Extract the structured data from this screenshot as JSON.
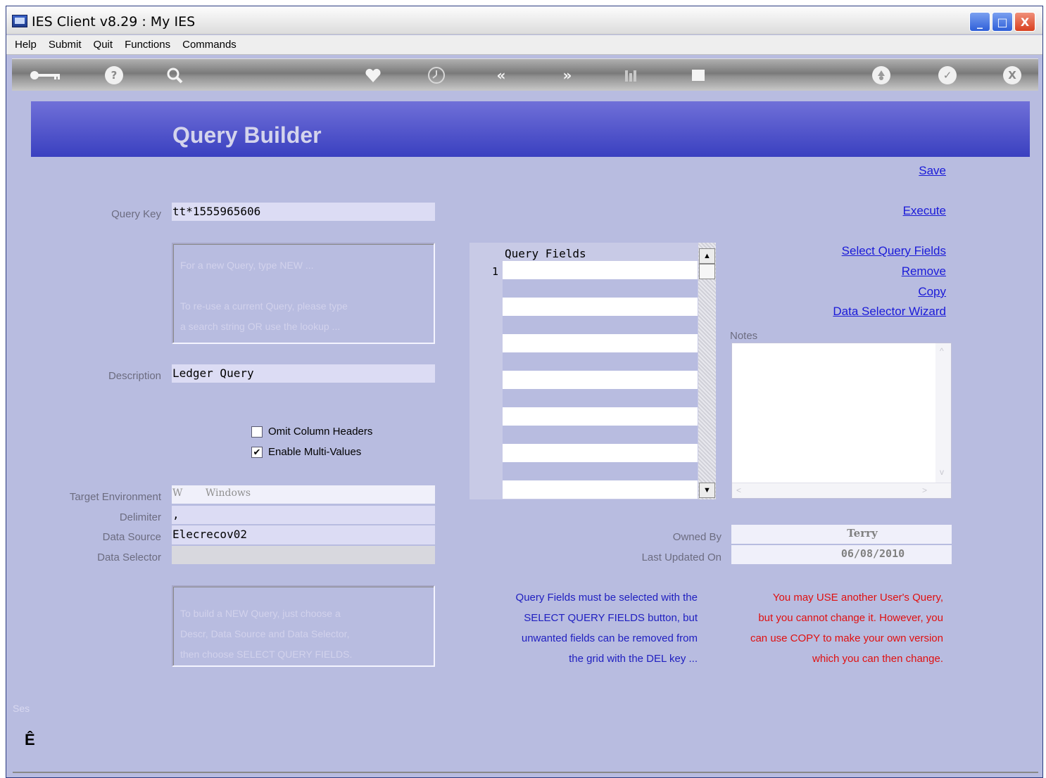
{
  "window": {
    "title": "IES Client v8.29 : My IES",
    "controls": {
      "minimize": "_",
      "maximize": "□",
      "close": "X"
    }
  },
  "menu": [
    "Help",
    "Submit",
    "Quit",
    "Functions",
    "Commands"
  ],
  "toolbar": {
    "icons": [
      "key-icon",
      "help-icon",
      "search-icon",
      "heart-icon",
      "clock-icon",
      "rewind-icon",
      "forward-icon",
      "tree-icon",
      "stop-icon",
      "recycle-icon",
      "check-icon",
      "close-icon"
    ],
    "help_glyph": "?",
    "rewind_glyph": "«",
    "forward_glyph": "»",
    "check_glyph": "✓",
    "close_glyph": "X"
  },
  "page": {
    "title": "Query Builder"
  },
  "links": {
    "save": "Save",
    "execute": "Execute",
    "select_query_fields": "Select Query Fields",
    "remove": "Remove",
    "copy": "Copy",
    "data_selector_wizard": "Data Selector Wizard"
  },
  "form": {
    "query_key_label": "Query Key",
    "query_key_value": "tt*1555965606",
    "hint1": [
      "For a new Query, type NEW ...",
      "",
      "To re-use a current Query, please type",
      "a search string OR use the lookup ..."
    ],
    "description_label": "Description",
    "description_value": "Ledger Query",
    "omit_headers_label": "Omit Column Headers",
    "omit_headers_checked": false,
    "multi_values_label": "Enable Multi-Values",
    "multi_values_checked": true,
    "multi_values_check_glyph": "✔",
    "target_env_label": "Target Environment",
    "target_env_code": "W",
    "target_env_value": "Windows",
    "delimiter_label": "Delimiter",
    "delimiter_value": ",",
    "data_source_label": "Data Source",
    "data_source_value": "Elecrecov02",
    "data_selector_label": "Data Selector",
    "data_selector_value": "",
    "hint2": [
      "To build a NEW Query, just choose a",
      "Descr, Data Source and Data Selector,",
      "then choose SELECT QUERY FIELDS."
    ]
  },
  "grid": {
    "header": "Query Fields",
    "row_number": "1",
    "scroll_up_glyph": "▲",
    "scroll_down_glyph": "▼"
  },
  "notes": {
    "label": "Notes",
    "value": "",
    "scroll_up_glyph": "^",
    "scroll_down_glyph": "v",
    "scroll_left_glyph": "<",
    "scroll_right_glyph": ">"
  },
  "owner": {
    "owned_by_label": "Owned By",
    "owned_by_value": "Terry",
    "last_updated_label": "Last Updated On",
    "last_updated_value": "06/08/2010"
  },
  "info": {
    "blue": [
      "Query Fields must be selected with the",
      "SELECT QUERY FIELDS button, but",
      "unwanted fields can be removed from",
      "the grid with the DEL key ..."
    ],
    "red": [
      "You may USE another User's Query,",
      "but you cannot change it. However, you",
      "can use COPY to make your own version",
      "which you can then change."
    ]
  },
  "status": {
    "text": "Ses",
    "icon_glyph": "Ê"
  },
  "colors": {
    "banner": "#4a50c8",
    "background": "#b8bce0",
    "link": "#1a1ad8",
    "info_blue": "#2020c0",
    "info_red": "#e01010"
  }
}
